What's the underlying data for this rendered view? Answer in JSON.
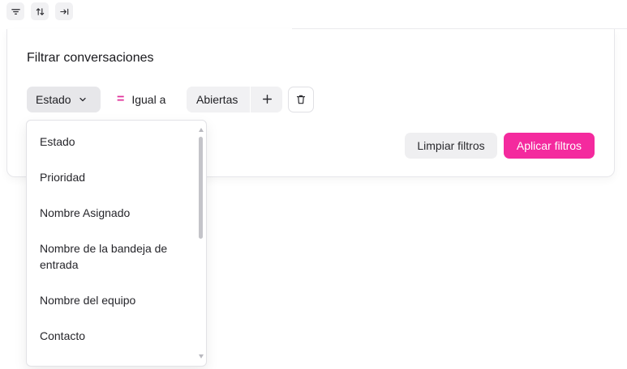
{
  "toolbar": {
    "icons": [
      "filter-lines-icon",
      "sort-arrows-icon",
      "arrow-to-right-icon"
    ]
  },
  "filter_panel": {
    "title": "Filtrar conversaciones",
    "attribute_label": "Estado",
    "operator_symbol": "=",
    "operator_label": "Igual a",
    "value_label": "Abiertas",
    "add_icon": "plus-icon",
    "delete_icon": "trash-icon",
    "clear_button": "Limpiar filtros",
    "apply_button": "Aplicar filtros"
  },
  "attribute_dropdown": {
    "options": [
      "Estado",
      "Prioridad",
      "Nombre Asignado",
      "Nombre de la bandeja de entrada",
      "Nombre del equipo",
      "Contacto"
    ]
  },
  "colors": {
    "accent": "#f42a9e",
    "operator": "#e0329a",
    "chip_bg": "#e7e7ea"
  }
}
